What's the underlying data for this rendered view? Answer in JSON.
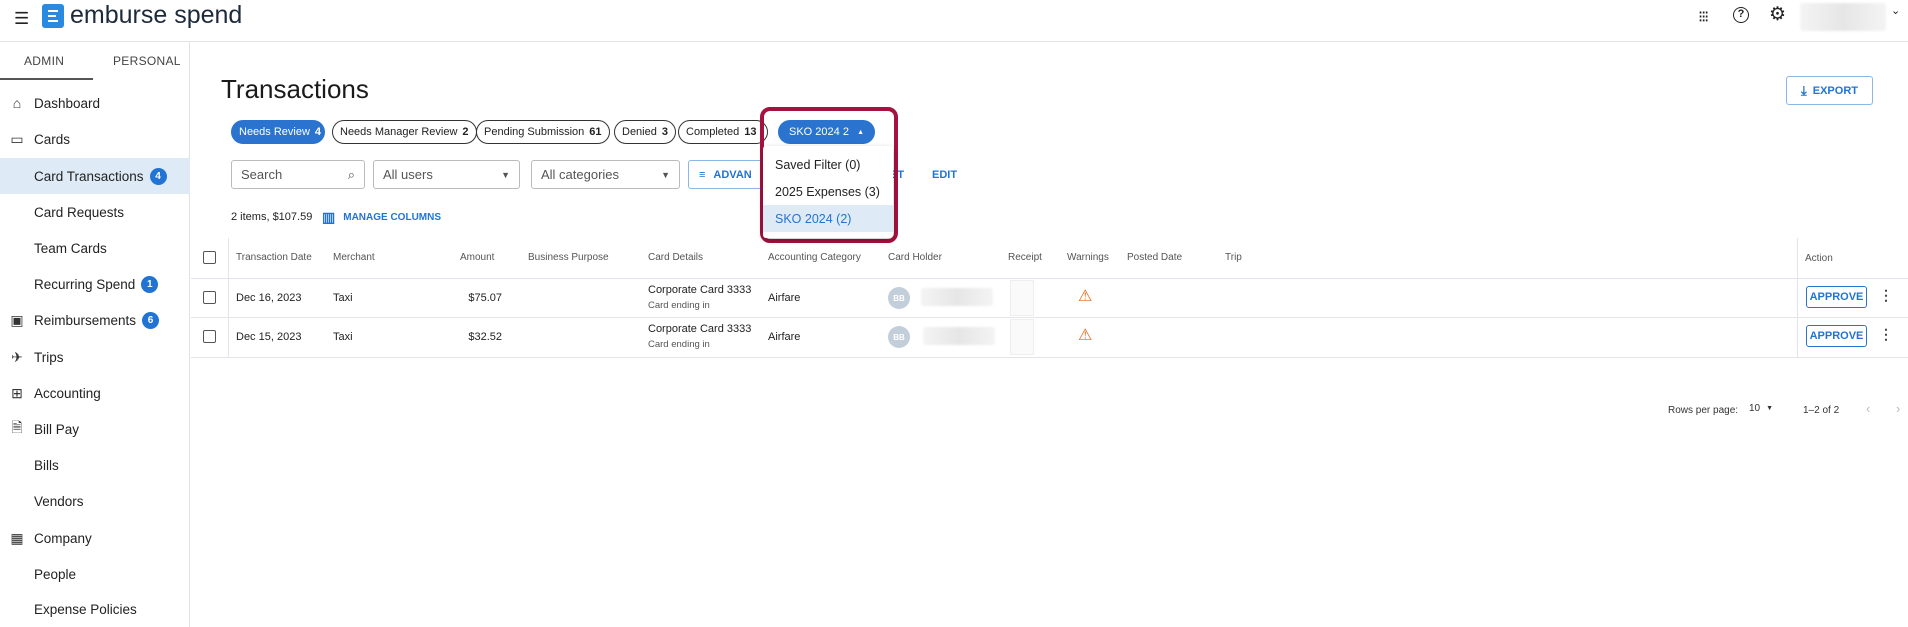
{
  "app": {
    "brand": "emburse spend"
  },
  "sidebar": {
    "tabs": [
      "ADMIN",
      "PERSONAL"
    ],
    "items": [
      {
        "label": "Dashboard",
        "icon": "home-icon"
      },
      {
        "label": "Cards",
        "icon": "cards-icon"
      },
      {
        "label": "Card Transactions",
        "badge": "4",
        "active": true
      },
      {
        "label": "Card Requests"
      },
      {
        "label": "Team Cards"
      },
      {
        "label": "Recurring Spend",
        "badge": "1"
      },
      {
        "label": "Reimbursements",
        "icon": "money-icon",
        "badge": "6"
      },
      {
        "label": "Trips",
        "icon": "plane-icon"
      },
      {
        "label": "Accounting",
        "icon": "calculator-icon"
      },
      {
        "label": "Bill Pay",
        "icon": "bill-icon"
      },
      {
        "label": "Bills"
      },
      {
        "label": "Vendors"
      },
      {
        "label": "Company",
        "icon": "building-icon"
      },
      {
        "label": "People"
      },
      {
        "label": "Expense Policies"
      }
    ]
  },
  "main": {
    "title": "Transactions",
    "export_label": "EXPORT",
    "chips": [
      {
        "label": "Needs Review",
        "count": "4"
      },
      {
        "label": "Needs Manager Review",
        "count": "2"
      },
      {
        "label": "Pending Submission",
        "count": "61"
      },
      {
        "label": "Denied",
        "count": "3"
      },
      {
        "label": "Completed",
        "count": "13"
      }
    ],
    "saved_filter": {
      "label": "SKO 2024",
      "count": "2",
      "options": [
        "Saved Filter (0)",
        "2025 Expenses (3)",
        "SKO 2024 (2)"
      ],
      "selected": "SKO 2024 (2)"
    },
    "search_placeholder": "Search",
    "users_select": "All users",
    "categories_select": "All categories",
    "advanced_label": "ADVAN",
    "reset_fragment": "ET",
    "edit_label": "EDIT",
    "summary": "2 items, $107.59",
    "manage_columns": "MANAGE COLUMNS",
    "columns": [
      "Transaction Date",
      "Merchant",
      "Amount",
      "Business Purpose",
      "Card Details",
      "Accounting Category",
      "Card Holder",
      "Receipt",
      "Warnings",
      "Posted Date",
      "Trip",
      "Action"
    ],
    "rows": [
      {
        "date": "Dec 16, 2023",
        "merchant": "Taxi",
        "amount": "$75.07",
        "card": "Corporate Card 3333",
        "card_sub": "Card ending in",
        "category": "Airfare",
        "initials": "BB",
        "action": "APPROVE"
      },
      {
        "date": "Dec 15, 2023",
        "merchant": "Taxi",
        "amount": "$32.52",
        "card": "Corporate Card 3333",
        "card_sub": "Card ending in",
        "category": "Airfare",
        "initials": "BB",
        "action": "APPROVE"
      }
    ],
    "pagination": {
      "rows_per_page_label": "Rows per page:",
      "rows_per_page": "10",
      "range": "1–2 of 2"
    }
  },
  "colors": {
    "accent": "#2174d4",
    "highlight_border": "#a5123f",
    "warning": "#e8671c"
  }
}
